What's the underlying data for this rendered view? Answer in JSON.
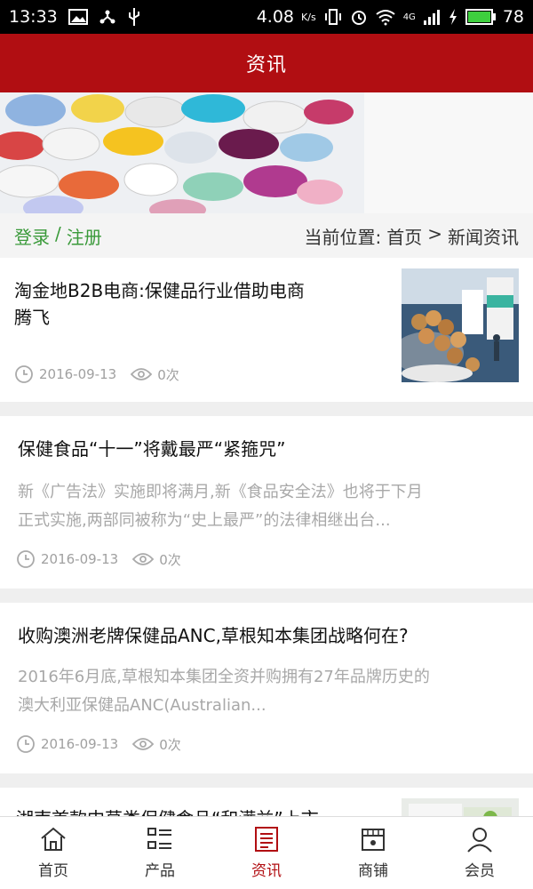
{
  "status_bar": {
    "time": "13:33",
    "speed": "4.08",
    "speed_unit": "K/s",
    "network": "4G",
    "battery": "78"
  },
  "header": {
    "title": "资讯"
  },
  "colors": {
    "brand": "#b10e12",
    "auth_green": "#3a9a3a",
    "muted": "#a8a8a8"
  },
  "auth": {
    "login": "登录",
    "separator": "/",
    "register": "注册"
  },
  "breadcrumb": {
    "prefix": "当前位置:",
    "home": "首页",
    "arrow": ">",
    "current": "新闻资讯"
  },
  "news": [
    {
      "title_line1": "淘金地B2B电商:保健品行业借助电商",
      "title_line2": "腾飞",
      "date": "2016-09-13",
      "views": "0次"
    },
    {
      "title": "保健食品“十一”将戴最严“紧箍咒”",
      "summary_line1": "新《广告法》实施即将满月,新《食品安全法》也将于下月",
      "summary_line2": "正式实施,两部同被称为“史上最严”的法律相继出台...",
      "date": "2016-09-13",
      "views": "0次"
    },
    {
      "title": "收购澳洲老牌保健品ANC,草根知本集团战略何在?",
      "summary_line1": "2016年6月底,草根知本集团全资并购拥有27年品牌历史的",
      "summary_line2": "澳大利亚保健品ANC(Australian...",
      "date": "2016-09-13",
      "views": "0次"
    },
    {
      "title_partial": "湖南首款中草类保健食品“和满益”上市"
    }
  ],
  "tabs": [
    {
      "label": "首页",
      "icon": "home-icon"
    },
    {
      "label": "产品",
      "icon": "list-icon"
    },
    {
      "label": "资讯",
      "icon": "news-icon",
      "active": true
    },
    {
      "label": "商铺",
      "icon": "store-icon"
    },
    {
      "label": "会员",
      "icon": "user-icon"
    }
  ]
}
